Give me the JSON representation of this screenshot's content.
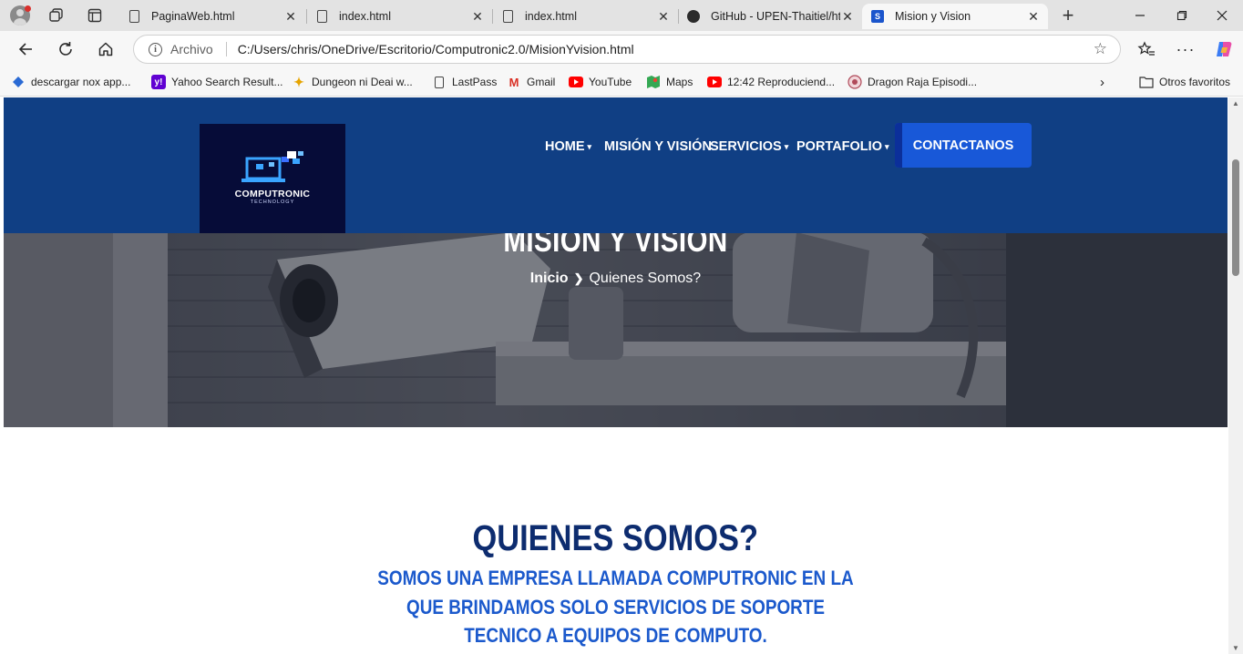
{
  "browser": {
    "tabs": [
      {
        "title": "PaginaWeb.html",
        "active": false,
        "icon": "document-icon"
      },
      {
        "title": "index.html",
        "active": false,
        "icon": "document-icon"
      },
      {
        "title": "index.html",
        "active": false,
        "icon": "document-icon"
      },
      {
        "title": "GitHub - UPEN-Thaitiel/html",
        "active": false,
        "icon": "github-icon"
      },
      {
        "title": "Mision y Vision",
        "active": true,
        "icon": "site-s-icon"
      }
    ],
    "close_glyph": "✕",
    "new_tab_glyph": "+",
    "address": {
      "scheme_label": "Archivo",
      "url": "C:/Users/chris/OneDrive/Escritorio/Computronic2.0/MisionYvision.html"
    },
    "bookmarks": [
      {
        "label": "descargar nox app...",
        "icon": "nox-icon",
        "color": "#2a6ad4"
      },
      {
        "label": "Yahoo Search Result...",
        "icon": "yahoo-icon",
        "color": "#6001d2"
      },
      {
        "label": "Dungeon ni Deai w...",
        "icon": "star-icon",
        "color": "#e6a400"
      },
      {
        "label": "LastPass",
        "icon": "document-icon",
        "color": "#555555"
      },
      {
        "label": "Gmail",
        "icon": "gmail-icon",
        "color": "#d93025"
      },
      {
        "label": "YouTube",
        "icon": "youtube-icon",
        "color": "#ff0000"
      },
      {
        "label": "Maps",
        "icon": "maps-icon",
        "color": "#34a853"
      },
      {
        "label": "12:42 Reproduciend...",
        "icon": "youtube-icon",
        "color": "#ff0000"
      },
      {
        "label": "Dragon Raja Episodi...",
        "icon": "dragon-icon",
        "color": "#b04a5a"
      }
    ],
    "other_favorites": "Otros favoritos"
  },
  "site": {
    "logo": {
      "name": "COMPUTRONIC",
      "tagline": "TECHNOLOGY"
    },
    "nav": [
      {
        "label": "HOME",
        "has_caret": true
      },
      {
        "label": "MISIÓN Y VISIÓN",
        "has_caret": false
      },
      {
        "label": "SERVICIOS",
        "has_caret": true
      },
      {
        "label": "PORTAFOLIO",
        "has_caret": true
      }
    ],
    "cta": "CONTACTANOS",
    "hero": {
      "title": "MISIÓN Y VISIÓN",
      "breadcrumb_home": "Inicio",
      "breadcrumb_sep": "❯",
      "breadcrumb_current": "Quienes Somos?"
    },
    "about": {
      "title": "QUIENES SOMOS?",
      "lines": [
        "SOMOS UNA EMPRESA LLAMADA COMPUTRONIC EN LA",
        "QUE BRINDAMOS SOLO SERVICIOS DE SOPORTE",
        "TECNICO A EQUIPOS DE COMPUTO."
      ]
    }
  },
  "colors": {
    "header_bg": "#103f84",
    "logo_bg": "#060c38",
    "cta_bg": "#1858d8",
    "title_dark": "#0d2c6f",
    "subtitle_blue": "#1b59cc"
  }
}
